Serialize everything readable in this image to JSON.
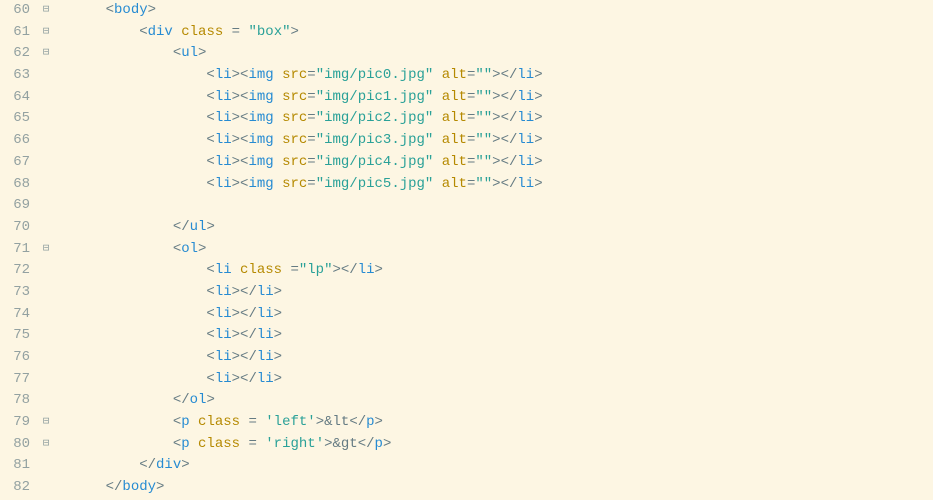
{
  "lineStart": 60,
  "lines": [
    {
      "num": 60,
      "fold": "⊟",
      "indent": 1,
      "parts": [
        {
          "t": "punc",
          "v": "<"
        },
        {
          "t": "tag",
          "v": "body"
        },
        {
          "t": "punc",
          "v": ">"
        }
      ]
    },
    {
      "num": 61,
      "fold": "⊟",
      "indent": 2,
      "parts": [
        {
          "t": "punc",
          "v": "<"
        },
        {
          "t": "tag",
          "v": "div"
        },
        {
          "t": "txt",
          "v": " "
        },
        {
          "t": "attr",
          "v": "class"
        },
        {
          "t": "txt",
          "v": " "
        },
        {
          "t": "op",
          "v": "="
        },
        {
          "t": "txt",
          "v": " "
        },
        {
          "t": "str",
          "v": "\"box\""
        },
        {
          "t": "punc",
          "v": ">"
        }
      ]
    },
    {
      "num": 62,
      "fold": "⊟",
      "indent": 3,
      "parts": [
        {
          "t": "punc",
          "v": "<"
        },
        {
          "t": "tag",
          "v": "ul"
        },
        {
          "t": "punc",
          "v": ">"
        }
      ]
    },
    {
      "num": 63,
      "fold": "",
      "indent": 4,
      "parts": [
        {
          "t": "punc",
          "v": "<"
        },
        {
          "t": "tag",
          "v": "li"
        },
        {
          "t": "punc",
          "v": "><"
        },
        {
          "t": "tag",
          "v": "img"
        },
        {
          "t": "txt",
          "v": " "
        },
        {
          "t": "attr",
          "v": "src"
        },
        {
          "t": "op",
          "v": "="
        },
        {
          "t": "str",
          "v": "\"img/pic0.jpg\""
        },
        {
          "t": "txt",
          "v": " "
        },
        {
          "t": "attr",
          "v": "alt"
        },
        {
          "t": "op",
          "v": "="
        },
        {
          "t": "str",
          "v": "\"\""
        },
        {
          "t": "punc",
          "v": "></"
        },
        {
          "t": "tag",
          "v": "li"
        },
        {
          "t": "punc",
          "v": ">"
        }
      ]
    },
    {
      "num": 64,
      "fold": "",
      "indent": 4,
      "parts": [
        {
          "t": "punc",
          "v": "<"
        },
        {
          "t": "tag",
          "v": "li"
        },
        {
          "t": "punc",
          "v": "><"
        },
        {
          "t": "tag",
          "v": "img"
        },
        {
          "t": "txt",
          "v": " "
        },
        {
          "t": "attr",
          "v": "src"
        },
        {
          "t": "op",
          "v": "="
        },
        {
          "t": "str",
          "v": "\"img/pic1.jpg\""
        },
        {
          "t": "txt",
          "v": " "
        },
        {
          "t": "attr",
          "v": "alt"
        },
        {
          "t": "op",
          "v": "="
        },
        {
          "t": "str",
          "v": "\"\""
        },
        {
          "t": "punc",
          "v": "></"
        },
        {
          "t": "tag",
          "v": "li"
        },
        {
          "t": "punc",
          "v": ">"
        }
      ]
    },
    {
      "num": 65,
      "fold": "",
      "indent": 4,
      "parts": [
        {
          "t": "punc",
          "v": "<"
        },
        {
          "t": "tag",
          "v": "li"
        },
        {
          "t": "punc",
          "v": "><"
        },
        {
          "t": "tag",
          "v": "img"
        },
        {
          "t": "txt",
          "v": " "
        },
        {
          "t": "attr",
          "v": "src"
        },
        {
          "t": "op",
          "v": "="
        },
        {
          "t": "str",
          "v": "\"img/pic2.jpg\""
        },
        {
          "t": "txt",
          "v": " "
        },
        {
          "t": "attr",
          "v": "alt"
        },
        {
          "t": "op",
          "v": "="
        },
        {
          "t": "str",
          "v": "\"\""
        },
        {
          "t": "punc",
          "v": "></"
        },
        {
          "t": "tag",
          "v": "li"
        },
        {
          "t": "punc",
          "v": ">"
        }
      ]
    },
    {
      "num": 66,
      "fold": "",
      "indent": 4,
      "parts": [
        {
          "t": "punc",
          "v": "<"
        },
        {
          "t": "tag",
          "v": "li"
        },
        {
          "t": "punc",
          "v": "><"
        },
        {
          "t": "tag",
          "v": "img"
        },
        {
          "t": "txt",
          "v": " "
        },
        {
          "t": "attr",
          "v": "src"
        },
        {
          "t": "op",
          "v": "="
        },
        {
          "t": "str",
          "v": "\"img/pic3.jpg\""
        },
        {
          "t": "txt",
          "v": " "
        },
        {
          "t": "attr",
          "v": "alt"
        },
        {
          "t": "op",
          "v": "="
        },
        {
          "t": "str",
          "v": "\"\""
        },
        {
          "t": "punc",
          "v": "></"
        },
        {
          "t": "tag",
          "v": "li"
        },
        {
          "t": "punc",
          "v": ">"
        }
      ]
    },
    {
      "num": 67,
      "fold": "",
      "indent": 4,
      "parts": [
        {
          "t": "punc",
          "v": "<"
        },
        {
          "t": "tag",
          "v": "li"
        },
        {
          "t": "punc",
          "v": "><"
        },
        {
          "t": "tag",
          "v": "img"
        },
        {
          "t": "txt",
          "v": " "
        },
        {
          "t": "attr",
          "v": "src"
        },
        {
          "t": "op",
          "v": "="
        },
        {
          "t": "str",
          "v": "\"img/pic4.jpg\""
        },
        {
          "t": "txt",
          "v": " "
        },
        {
          "t": "attr",
          "v": "alt"
        },
        {
          "t": "op",
          "v": "="
        },
        {
          "t": "str",
          "v": "\"\""
        },
        {
          "t": "punc",
          "v": "></"
        },
        {
          "t": "tag",
          "v": "li"
        },
        {
          "t": "punc",
          "v": ">"
        }
      ]
    },
    {
      "num": 68,
      "fold": "",
      "indent": 4,
      "parts": [
        {
          "t": "punc",
          "v": "<"
        },
        {
          "t": "tag",
          "v": "li"
        },
        {
          "t": "punc",
          "v": "><"
        },
        {
          "t": "tag",
          "v": "img"
        },
        {
          "t": "txt",
          "v": " "
        },
        {
          "t": "attr",
          "v": "src"
        },
        {
          "t": "op",
          "v": "="
        },
        {
          "t": "str",
          "v": "\"img/pic5.jpg\""
        },
        {
          "t": "txt",
          "v": " "
        },
        {
          "t": "attr",
          "v": "alt"
        },
        {
          "t": "op",
          "v": "="
        },
        {
          "t": "str",
          "v": "\"\""
        },
        {
          "t": "punc",
          "v": "></"
        },
        {
          "t": "tag",
          "v": "li"
        },
        {
          "t": "punc",
          "v": ">"
        }
      ]
    },
    {
      "num": 69,
      "fold": "",
      "indent": 0,
      "parts": []
    },
    {
      "num": 70,
      "fold": "",
      "indent": 3,
      "parts": [
        {
          "t": "punc",
          "v": "</"
        },
        {
          "t": "tag",
          "v": "ul"
        },
        {
          "t": "punc",
          "v": ">"
        }
      ]
    },
    {
      "num": 71,
      "fold": "⊟",
      "indent": 3,
      "parts": [
        {
          "t": "punc",
          "v": "<"
        },
        {
          "t": "tag",
          "v": "ol"
        },
        {
          "t": "punc",
          "v": ">"
        }
      ]
    },
    {
      "num": 72,
      "fold": "",
      "indent": 4,
      "parts": [
        {
          "t": "punc",
          "v": "<"
        },
        {
          "t": "tag",
          "v": "li"
        },
        {
          "t": "txt",
          "v": " "
        },
        {
          "t": "attr",
          "v": "class"
        },
        {
          "t": "txt",
          "v": " "
        },
        {
          "t": "op",
          "v": "="
        },
        {
          "t": "str",
          "v": "\"lp\""
        },
        {
          "t": "punc",
          "v": "></"
        },
        {
          "t": "tag",
          "v": "li"
        },
        {
          "t": "punc",
          "v": ">"
        }
      ]
    },
    {
      "num": 73,
      "fold": "",
      "indent": 4,
      "parts": [
        {
          "t": "punc",
          "v": "<"
        },
        {
          "t": "tag",
          "v": "li"
        },
        {
          "t": "punc",
          "v": "></"
        },
        {
          "t": "tag",
          "v": "li"
        },
        {
          "t": "punc",
          "v": ">"
        }
      ]
    },
    {
      "num": 74,
      "fold": "",
      "indent": 4,
      "parts": [
        {
          "t": "punc",
          "v": "<"
        },
        {
          "t": "tag",
          "v": "li"
        },
        {
          "t": "punc",
          "v": "></"
        },
        {
          "t": "tag",
          "v": "li"
        },
        {
          "t": "punc",
          "v": ">"
        }
      ]
    },
    {
      "num": 75,
      "fold": "",
      "indent": 4,
      "parts": [
        {
          "t": "punc",
          "v": "<"
        },
        {
          "t": "tag",
          "v": "li"
        },
        {
          "t": "punc",
          "v": "></"
        },
        {
          "t": "tag",
          "v": "li"
        },
        {
          "t": "punc",
          "v": ">"
        }
      ]
    },
    {
      "num": 76,
      "fold": "",
      "indent": 4,
      "parts": [
        {
          "t": "punc",
          "v": "<"
        },
        {
          "t": "tag",
          "v": "li"
        },
        {
          "t": "punc",
          "v": "></"
        },
        {
          "t": "tag",
          "v": "li"
        },
        {
          "t": "punc",
          "v": ">"
        }
      ]
    },
    {
      "num": 77,
      "fold": "",
      "indent": 4,
      "parts": [
        {
          "t": "punc",
          "v": "<"
        },
        {
          "t": "tag",
          "v": "li"
        },
        {
          "t": "punc",
          "v": "></"
        },
        {
          "t": "tag",
          "v": "li"
        },
        {
          "t": "punc",
          "v": ">"
        }
      ]
    },
    {
      "num": 78,
      "fold": "",
      "indent": 3,
      "parts": [
        {
          "t": "punc",
          "v": "</"
        },
        {
          "t": "tag",
          "v": "ol"
        },
        {
          "t": "punc",
          "v": ">"
        }
      ]
    },
    {
      "num": 79,
      "fold": "⊟",
      "indent": 3,
      "parts": [
        {
          "t": "punc",
          "v": "<"
        },
        {
          "t": "tag",
          "v": "p"
        },
        {
          "t": "txt",
          "v": " "
        },
        {
          "t": "attr",
          "v": "class"
        },
        {
          "t": "txt",
          "v": " "
        },
        {
          "t": "op",
          "v": "="
        },
        {
          "t": "txt",
          "v": " "
        },
        {
          "t": "str",
          "v": "'left'"
        },
        {
          "t": "punc",
          "v": ">"
        },
        {
          "t": "txt",
          "v": "&lt"
        },
        {
          "t": "punc",
          "v": "</"
        },
        {
          "t": "tag",
          "v": "p"
        },
        {
          "t": "punc",
          "v": ">"
        }
      ]
    },
    {
      "num": 80,
      "fold": "⊟",
      "indent": 3,
      "parts": [
        {
          "t": "punc",
          "v": "<"
        },
        {
          "t": "tag",
          "v": "p"
        },
        {
          "t": "txt",
          "v": " "
        },
        {
          "t": "attr",
          "v": "class"
        },
        {
          "t": "txt",
          "v": " "
        },
        {
          "t": "op",
          "v": "="
        },
        {
          "t": "txt",
          "v": " "
        },
        {
          "t": "str",
          "v": "'right'"
        },
        {
          "t": "punc",
          "v": ">"
        },
        {
          "t": "txt",
          "v": "&gt"
        },
        {
          "t": "punc",
          "v": "</"
        },
        {
          "t": "tag",
          "v": "p"
        },
        {
          "t": "punc",
          "v": ">"
        }
      ]
    },
    {
      "num": 81,
      "fold": "",
      "indent": 2,
      "parts": [
        {
          "t": "punc",
          "v": "</"
        },
        {
          "t": "tag",
          "v": "div"
        },
        {
          "t": "punc",
          "v": ">"
        }
      ]
    },
    {
      "num": 82,
      "fold": "",
      "indent": 1,
      "parts": [
        {
          "t": "punc",
          "v": "</"
        },
        {
          "t": "tag",
          "v": "body"
        },
        {
          "t": "punc",
          "v": ">"
        }
      ]
    }
  ],
  "indentUnit": "    "
}
